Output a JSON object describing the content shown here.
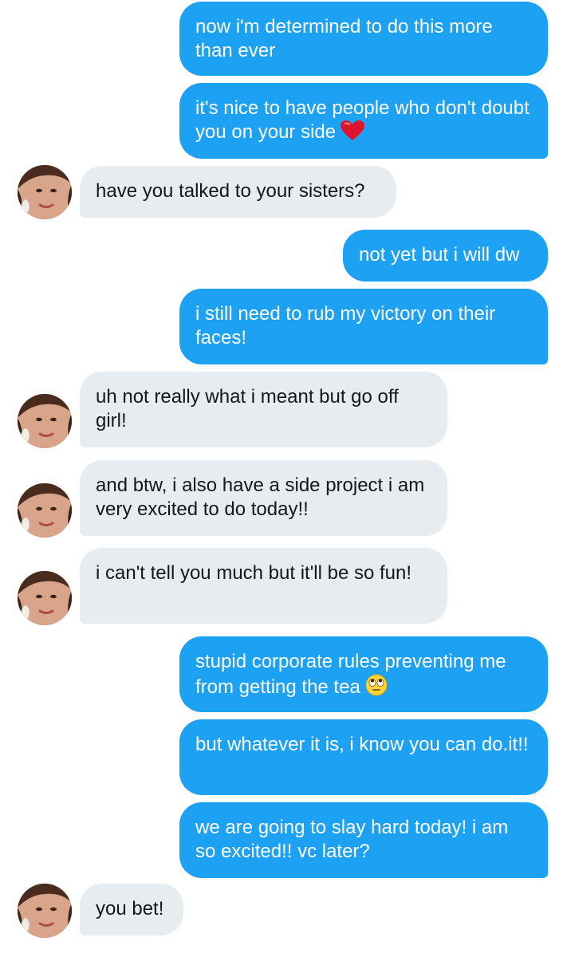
{
  "colors": {
    "sent_bubble": "#1da1f2",
    "received_bubble": "#e6ecf0",
    "sent_text": "#ffffff",
    "received_text": "#14171a"
  },
  "messages": [
    {
      "direction": "sent",
      "text": "now i'm determined to do this more than ever"
    },
    {
      "direction": "sent",
      "text": "it's nice to have people who don't doubt you on your side",
      "emoji": "red-heart-emoji"
    },
    {
      "direction": "received",
      "text": "have you talked to your sisters?"
    },
    {
      "direction": "sent",
      "text": "not yet but i will dw"
    },
    {
      "direction": "sent",
      "text": "i still need to rub my victory on their faces!"
    },
    {
      "direction": "received",
      "text": "uh not really what i meant but go off girl!"
    },
    {
      "direction": "received",
      "text": "and btw, i also have a side project i am very excited to do today!!"
    },
    {
      "direction": "received",
      "text": "i can't tell you much but it'll be so fun!"
    },
    {
      "direction": "sent",
      "text": "stupid corporate rules preventing me from getting the tea",
      "emoji": "eye-roll-emoji"
    },
    {
      "direction": "sent",
      "text": "but whatever it is, i know you can do.it!!"
    },
    {
      "direction": "sent",
      "text": "we are going to slay hard today! i am so excited!! vc later?"
    },
    {
      "direction": "received",
      "text": "you bet!"
    }
  ]
}
